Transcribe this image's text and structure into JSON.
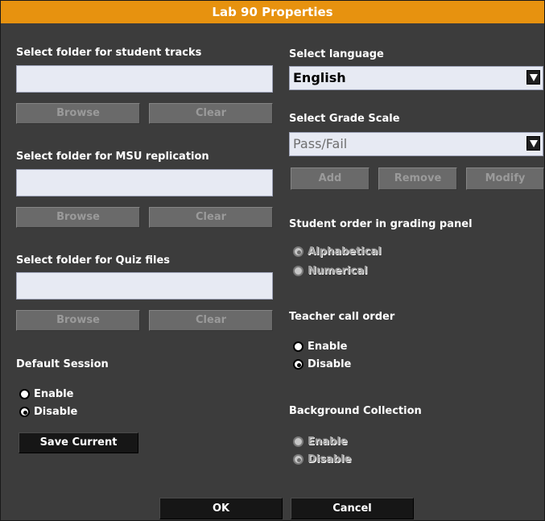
{
  "title": "Lab 90 Properties",
  "left": {
    "student_tracks": {
      "label": "Select folder for student tracks",
      "value": "",
      "browse": "Browse",
      "clear": "Clear"
    },
    "msu_replication": {
      "label": "Select folder for MSU replication",
      "value": "",
      "browse": "Browse",
      "clear": "Clear"
    },
    "quiz_files": {
      "label": "Select folder for Quiz files",
      "value": "",
      "browse": "Browse",
      "clear": "Clear"
    },
    "default_session": {
      "label": "Default Session",
      "enable": "Enable",
      "disable": "Disable",
      "selected": "Disable"
    },
    "save_current": "Save Current"
  },
  "right": {
    "language": {
      "label": "Select language",
      "value": "English"
    },
    "grade_scale": {
      "label": "Select Grade Scale",
      "value": "Pass/Fail",
      "add": "Add",
      "remove": "Remove",
      "modify": "Modify"
    },
    "student_order": {
      "label": "Student order in grading panel",
      "alphabetical": "Alphabetical",
      "numerical": "Numerical",
      "selected": "Alphabetical"
    },
    "teacher_call": {
      "label": "Teacher call order",
      "enable": "Enable",
      "disable": "Disable",
      "selected": "Disable"
    },
    "background_collection": {
      "label": "Background Collection",
      "enable": "Enable",
      "disable": "Disable",
      "selected": "Disable"
    }
  },
  "footer": {
    "ok": "OK",
    "cancel": "Cancel"
  },
  "colors": {
    "title_bar": "#e7920f",
    "panel": "#3c3c3c",
    "field": "#e7eaf3"
  }
}
